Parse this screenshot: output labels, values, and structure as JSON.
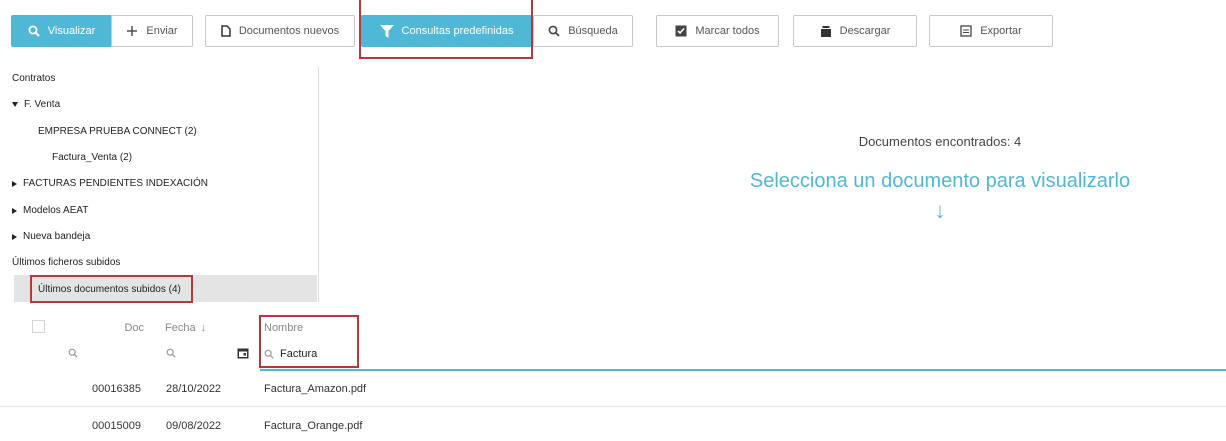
{
  "toolbar": {
    "visualizar": "Visualizar",
    "enviar": "Enviar",
    "documentos_nuevos": "Documentos nuevos",
    "consultas_predefinidas": "Consultas predefinidas",
    "busqueda": "Búsqueda",
    "marcar_todos": "Marcar todos",
    "descargar": "Descargar",
    "exportar": "Exportar"
  },
  "tree": {
    "items": [
      {
        "label": "Contratos"
      },
      {
        "label": "F. Venta"
      },
      {
        "label": "EMPRESA PRUEBA CONNECT (2)"
      },
      {
        "label": "Factura_Venta (2)"
      },
      {
        "label": "FACTURAS PENDIENTES INDEXACIÓN"
      },
      {
        "label": "Modelos AEAT"
      },
      {
        "label": "Nueva bandeja"
      },
      {
        "label": "Últimos ficheros subidos"
      },
      {
        "label": "Últimos documentos subidos (4)"
      }
    ]
  },
  "viewer": {
    "found_text": "Documentos encontrados: 4",
    "prompt": "Selecciona un documento para visualizarlo",
    "arrow": "↓"
  },
  "table": {
    "columns": {
      "doc": "Doc",
      "fecha": "Fecha",
      "fecha_sort": "↓",
      "nombre": "Nombre"
    },
    "filter": {
      "nombre_value": "Factura"
    },
    "rows": [
      {
        "doc": "00016385",
        "fecha": "28/10/2022",
        "nombre": "Factura_Amazon.pdf"
      },
      {
        "doc": "00015009",
        "fecha": "09/08/2022",
        "nombre": "Factura_Orange.pdf"
      }
    ]
  },
  "colors": {
    "accent": "#4fb8d7",
    "highlight": "#b8383e"
  }
}
